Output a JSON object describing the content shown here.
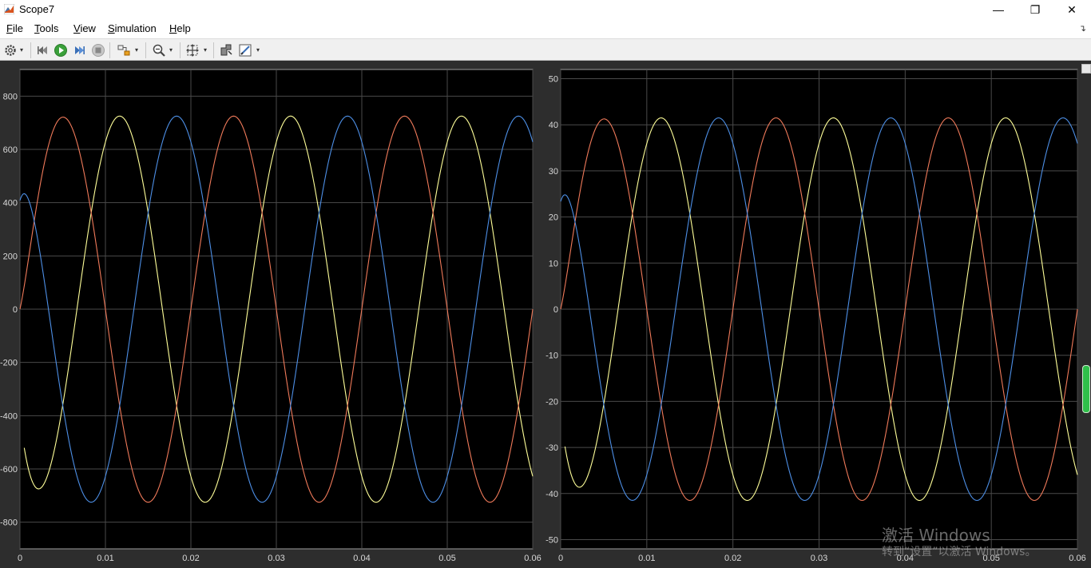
{
  "window": {
    "title": "Scope7",
    "minimize_glyph": "—",
    "restore_glyph": "❐",
    "close_glyph": "✕"
  },
  "menu": {
    "items": [
      {
        "prefix": "",
        "underline": "F",
        "rest": "ile"
      },
      {
        "prefix": "",
        "underline": "T",
        "rest": "ools"
      },
      {
        "prefix": "",
        "underline": "V",
        "rest": "iew"
      },
      {
        "prefix": "",
        "underline": "S",
        "rest": "imulation"
      },
      {
        "prefix": "",
        "underline": "H",
        "rest": "elp"
      }
    ],
    "corner_glyph": "↴"
  },
  "toolbar": {
    "icons": [
      "gear-icon",
      "step-back-icon",
      "run-icon",
      "step-forward-icon",
      "stop-icon",
      "highlight-block-icon",
      "zoom-icon",
      "autoscale-icon",
      "cursor-measure-icon",
      "style-icon"
    ],
    "dropdown_glyph": "▾"
  },
  "colors": {
    "plot_bg": "#000000",
    "figure_bg": "#2d2d2d",
    "grid": "#4a4a4a",
    "axis_text": "#d8d8d8",
    "series_yellow": "#ffff99",
    "series_orange": "#f07a5a",
    "series_blue": "#4d8fe6"
  },
  "chart_data": [
    {
      "type": "line",
      "title": "",
      "xlabel": "",
      "ylabel": "",
      "xlim": [
        0,
        0.06
      ],
      "ylim": [
        -900,
        900
      ],
      "xticks": [
        0,
        0.01,
        0.02,
        0.03,
        0.04,
        0.05,
        0.06
      ],
      "xtick_labels": [
        "0",
        "0.01",
        "0.02",
        "0.03",
        "0.04",
        "0.05",
        "0.06"
      ],
      "yticks": [
        -800,
        -600,
        -400,
        -200,
        0,
        200,
        400,
        600,
        800
      ],
      "ytick_labels": [
        "-800",
        "-600",
        "-400",
        "-200",
        "0",
        "200",
        "400",
        "600",
        "800"
      ],
      "grid": true,
      "legend": "none",
      "frequency_hz": 50,
      "series": [
        {
          "color": "#ffff99",
          "amplitude": 725,
          "phase_deg": -120,
          "start": 0.0005
        },
        {
          "color": "#f07a5a",
          "amplitude": 725,
          "phase_deg": 0,
          "start": 0.0
        },
        {
          "color": "#4d8fe6",
          "amplitude": 725,
          "phase_deg": 120,
          "start": 0.0
        }
      ]
    },
    {
      "type": "line",
      "title": "",
      "xlabel": "",
      "ylabel": "",
      "xlim": [
        0,
        0.06
      ],
      "ylim": [
        -52,
        52
      ],
      "xticks": [
        0,
        0.01,
        0.02,
        0.03,
        0.04,
        0.05,
        0.06
      ],
      "xtick_labels": [
        "0",
        "0.01",
        "0.02",
        "0.03",
        "0.04",
        "0.05",
        "0.06"
      ],
      "yticks": [
        -50,
        -40,
        -30,
        -20,
        -10,
        0,
        10,
        20,
        30,
        40,
        50
      ],
      "ytick_labels": [
        "-50",
        "-40",
        "-30",
        "-20",
        "-10",
        "0",
        "10",
        "20",
        "30",
        "40",
        "50"
      ],
      "grid": true,
      "legend": "none",
      "frequency_hz": 50,
      "series": [
        {
          "color": "#ffff99",
          "amplitude": 41.5,
          "phase_deg": -120,
          "start": 0.0005
        },
        {
          "color": "#f07a5a",
          "amplitude": 41.5,
          "phase_deg": 0,
          "start": 0.0
        },
        {
          "color": "#4d8fe6",
          "amplitude": 41.5,
          "phase_deg": 120,
          "start": 0.0
        }
      ]
    }
  ],
  "watermark": {
    "line1": "激活 Windows",
    "line2": "转到“设置”以激活 Windows。"
  }
}
